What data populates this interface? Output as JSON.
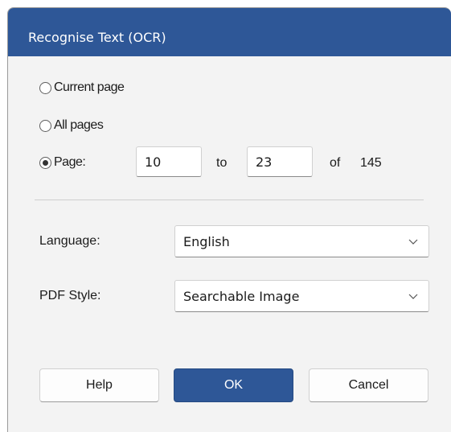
{
  "dialog": {
    "title": "Recognise Text (OCR)"
  },
  "range": {
    "options": [
      {
        "label": "Current page",
        "checked": false
      },
      {
        "label": "All pages",
        "checked": false
      },
      {
        "label": "Page:",
        "checked": true
      }
    ],
    "from_value": "10",
    "to_label": "to",
    "to_value": "23",
    "of_label": "of",
    "total_pages": "145"
  },
  "language": {
    "label": "Language:",
    "selected": "English"
  },
  "pdf_style": {
    "label": "PDF Style:",
    "selected": "Searchable Image"
  },
  "buttons": {
    "help": "Help",
    "ok": "OK",
    "cancel": "Cancel"
  },
  "icons": {
    "dropdown": "chevron-down-icon"
  },
  "colors": {
    "accent": "#2e5797",
    "dialog_background": "#f3f3f3"
  }
}
